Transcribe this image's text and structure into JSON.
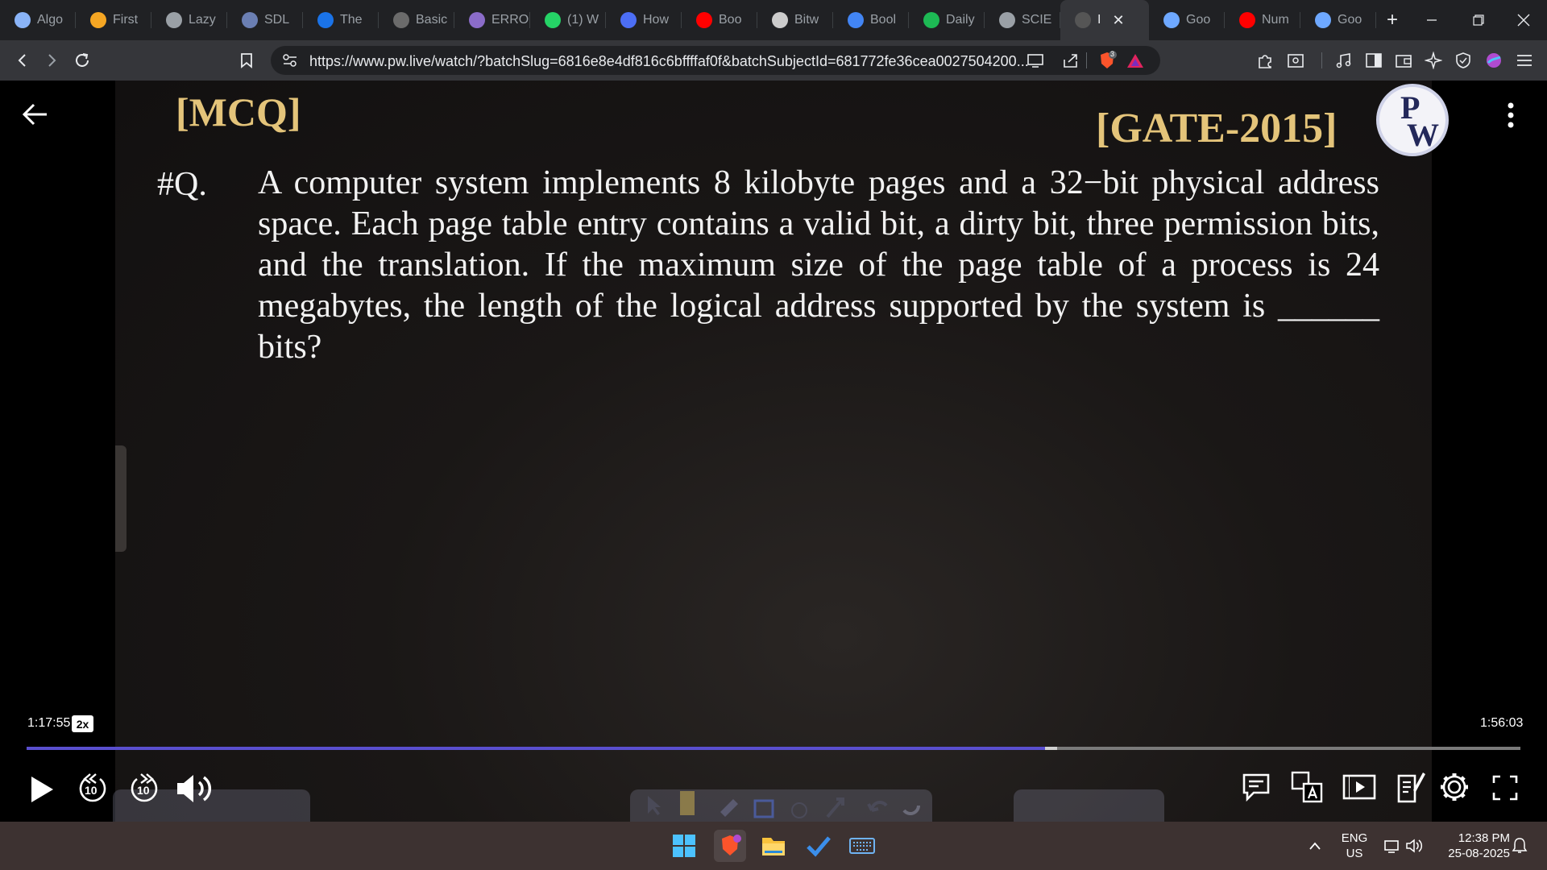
{
  "tabs": [
    {
      "label": "Algo",
      "icon": "globe-icon",
      "color": "#8ab4f8"
    },
    {
      "label": "First",
      "icon": "codeforces-icon",
      "color": "#f5a623"
    },
    {
      "label": "Lazy",
      "icon": "globe-icon",
      "color": "#9aa0a6"
    },
    {
      "label": "SDL",
      "icon": "book-icon",
      "color": "#6b7fb3"
    },
    {
      "label": "The",
      "icon": "w3-icon",
      "color": "#1a73e8"
    },
    {
      "label": "Basic",
      "icon": "grid-icon",
      "color": "#6b6b6b"
    },
    {
      "label": "ERRO",
      "icon": "globe-icon",
      "color": "#8b6cc9"
    },
    {
      "label": "(1) W",
      "icon": "whatsapp-icon",
      "color": "#25d366"
    },
    {
      "label": "How",
      "icon": "bookmark-icon",
      "color": "#4c6ef5"
    },
    {
      "label": "Boo",
      "icon": "youtube-icon",
      "color": "#ff0000"
    },
    {
      "label": "Bitw",
      "icon": "bitwise-icon",
      "color": "#cccccc"
    },
    {
      "label": "Bool",
      "icon": "google-icon",
      "color": "#4285f4"
    },
    {
      "label": "Daily",
      "icon": "spotify-icon",
      "color": "#1db954"
    },
    {
      "label": "SCIE",
      "icon": "globe-icon",
      "color": "#9aa0a6"
    },
    {
      "label": "I",
      "icon": "pw-icon",
      "color": "#555555",
      "active": true
    },
    {
      "label": "Goo",
      "icon": "gemini-icon",
      "color": "#6ea8ff"
    },
    {
      "label": "Num",
      "icon": "youtube-icon",
      "color": "#ff0000"
    },
    {
      "label": "Goo",
      "icon": "gemini-icon",
      "color": "#6ea8ff"
    }
  ],
  "browser": {
    "url": "https://www.pw.live/watch/?batchSlug=6816e8e4df816c6bffffaf0f&batchSubjectId=681772fe36cea0027504200...",
    "close_tab_glyph": "✕",
    "new_tab_glyph": "+",
    "brave_badge": "3"
  },
  "slide": {
    "tag": "[MCQ]",
    "exam": "[GATE-2015]",
    "logo_letters": [
      "P",
      "W"
    ],
    "question_number": "#Q.",
    "question_text": "A computer system implements 8 kilobyte pages and a 32−bit physical address space. Each page table entry contains a valid bit, a dirty bit, three permission bits, and the translation. If the maximum size of the page table of a process is 24 megabytes, the length of the logical address supported by the system is ______ bits?"
  },
  "player": {
    "current_time": "1:17:55",
    "speed": "2x",
    "duration": "1:56:03",
    "progress_fraction": 0.682,
    "buffered_fraction": 0.69,
    "rewind_seconds": "10",
    "forward_seconds": "10",
    "accent": "#5a4fcf"
  },
  "taskbar": {
    "language_top": "ENG",
    "language_bottom": "US",
    "time": "12:38 PM",
    "date": "25-08-2025"
  }
}
